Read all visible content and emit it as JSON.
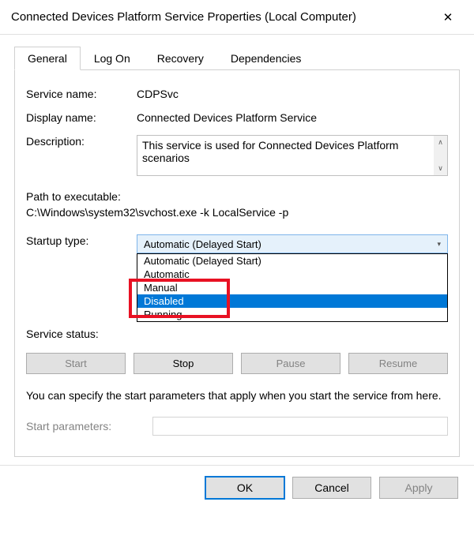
{
  "title": "Connected Devices Platform Service Properties (Local Computer)",
  "tabs": [
    "General",
    "Log On",
    "Recovery",
    "Dependencies"
  ],
  "labels": {
    "service_name": "Service name:",
    "display_name": "Display name:",
    "description": "Description:",
    "path": "Path to executable:",
    "startup_type": "Startup type:",
    "service_status": "Service status:",
    "start_params": "Start parameters:"
  },
  "values": {
    "service_name": "CDPSvc",
    "display_name": "Connected Devices Platform Service",
    "description": "This service is used for Connected Devices Platform scenarios",
    "path": "C:\\Windows\\system32\\svchost.exe -k LocalService -p",
    "startup_selected": "Automatic (Delayed Start)",
    "service_status": "Running"
  },
  "startup_options": [
    "Automatic (Delayed Start)",
    "Automatic",
    "Manual",
    "Disabled"
  ],
  "buttons": {
    "start": "Start",
    "stop": "Stop",
    "pause": "Pause",
    "resume": "Resume",
    "ok": "OK",
    "cancel": "Cancel",
    "apply": "Apply"
  },
  "info": "You can specify the start parameters that apply when you start the service from here."
}
